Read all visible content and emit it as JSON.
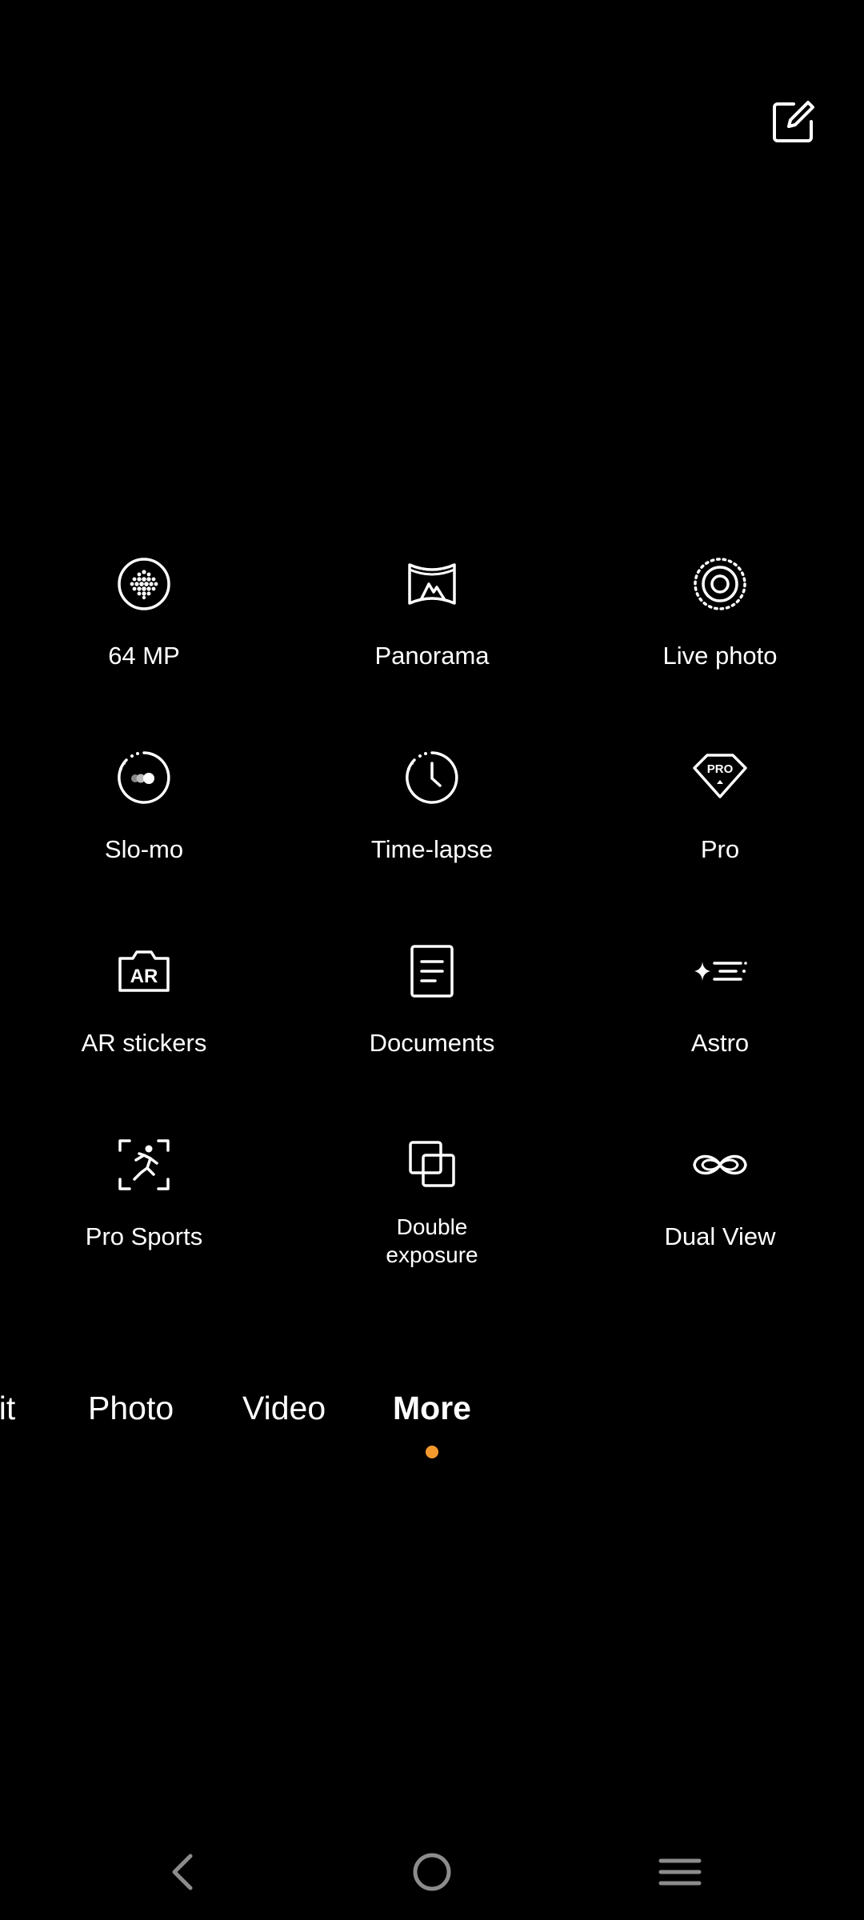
{
  "header": {
    "edit_icon": "edit-square-icon"
  },
  "modes": [
    {
      "label": "64 MP",
      "icon": "64mp-icon"
    },
    {
      "label": "Panorama",
      "icon": "panorama-icon"
    },
    {
      "label": "Live photo",
      "icon": "live-photo-icon"
    },
    {
      "label": "Slo-mo",
      "icon": "slow-motion-icon"
    },
    {
      "label": "Time-lapse",
      "icon": "time-lapse-icon"
    },
    {
      "label": "Pro",
      "icon": "pro-icon",
      "badge": "PRO"
    },
    {
      "label": "AR stickers",
      "icon": "ar-stickers-icon",
      "badge": "AR"
    },
    {
      "label": "Documents",
      "icon": "documents-icon"
    },
    {
      "label": "Astro",
      "icon": "astro-icon"
    },
    {
      "label": "Pro Sports",
      "icon": "pro-sports-icon"
    },
    {
      "label": "Double\nexposure",
      "icon": "double-exposure-icon"
    },
    {
      "label": "Dual View",
      "icon": "dual-view-icon"
    }
  ],
  "tabs": {
    "partial_left": "ait",
    "photo": "Photo",
    "video": "Video",
    "more": "More",
    "active": "More"
  },
  "colors": {
    "background": "#000000",
    "text": "#ffffff",
    "accent": "#f39a2c"
  },
  "nav": {
    "back_icon": "back-icon",
    "home_icon": "home-icon",
    "menu_icon": "menu-icon"
  }
}
